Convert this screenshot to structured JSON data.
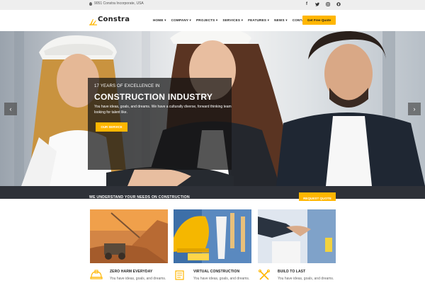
{
  "topbar": {
    "address": "9051 Constra Incorporate, USA",
    "socials": [
      "facebook-icon",
      "twitter-icon",
      "instagram-icon",
      "github-icon"
    ]
  },
  "header": {
    "logo_text": "Constra",
    "nav": [
      "HOME",
      "COMPANY",
      "PROJECTS",
      "SERVICES",
      "FEATURES",
      "NEWS",
      "CONTACT"
    ],
    "quote_button": "Get Free Quote"
  },
  "hero": {
    "years": "17 YEARS OF EXCELLENCE IN",
    "title": "CONSTRUCTION INDUSTRY",
    "description": "You have ideas, goals, and dreams. We have a culturally diverse, forward thinking team looking for talent like.",
    "button": "OUR SERVICE",
    "prev": "‹",
    "next": "›"
  },
  "actionbar": {
    "message": "WE UNDERSTAND YOUR NEEDS ON CONSTRUCTION",
    "button": "REQUEST QUOTE"
  },
  "features": [
    {
      "title": "ZERO HARM EVERYDAY",
      "desc": "You have ideas, goals, and dreams."
    },
    {
      "title": "VIRTUAL CONSTRUCTION",
      "desc": "You have ideas, goals, and dreams."
    },
    {
      "title": "BUILD TO LAST",
      "desc": "You have ideas, goals, and dreams."
    }
  ],
  "colors": {
    "accent": "#ffb600",
    "dark": "#2e3138",
    "topbar": "#eeeeee"
  }
}
